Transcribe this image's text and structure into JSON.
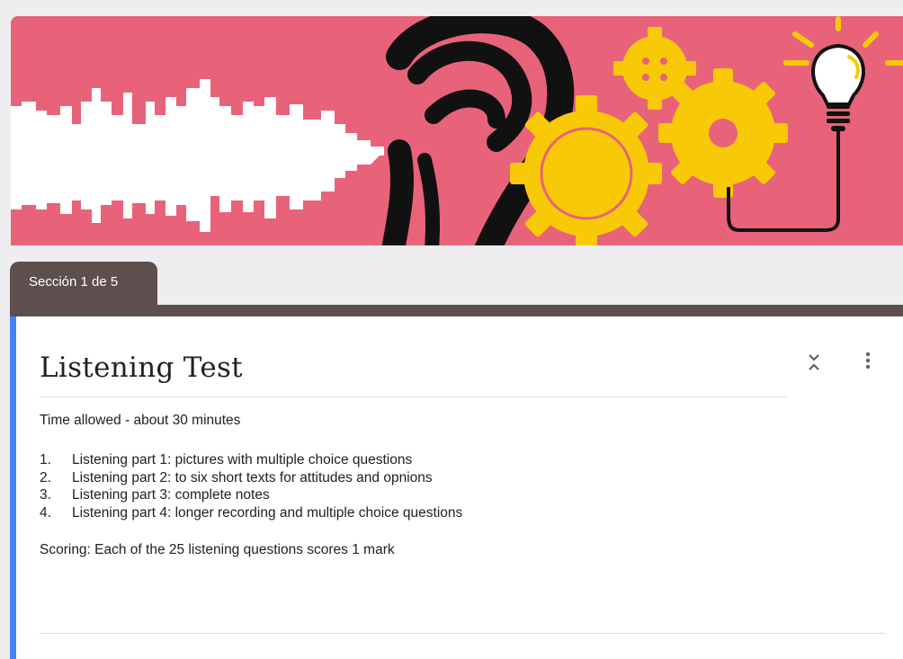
{
  "colors": {
    "banner_bg": "#e8637a",
    "theme": "#5e4f4f",
    "accent_bar": "#4285f4",
    "gear_yellow": "#f8c906",
    "ear_black": "#111111",
    "waveform_white": "#ffffff"
  },
  "banner": {
    "icons": [
      "sound-waveform-icon",
      "ear-icon",
      "gears-icon",
      "lightbulb-icon"
    ]
  },
  "section_tab": {
    "label": "Sección 1 de 5"
  },
  "form": {
    "title": "Listening Test",
    "icons": {
      "collapse": "collapse-icon",
      "more": "more-vert-icon"
    },
    "description": {
      "time": "Time allowed - about 30 minutes",
      "parts": [
        {
          "num": "1.",
          "text": "Listening part 1: pictures with multiple choice questions"
        },
        {
          "num": "2.",
          "text": "Listening part 2: to six short texts for attitudes and opnions"
        },
        {
          "num": "3.",
          "text": "Listening part 3: complete notes"
        },
        {
          "num": "4.",
          "text": "Listening part 4: longer recording and multiple choice questions"
        }
      ],
      "scoring": "Scoring: Each of the 25 listening questions scores 1 mark"
    }
  }
}
